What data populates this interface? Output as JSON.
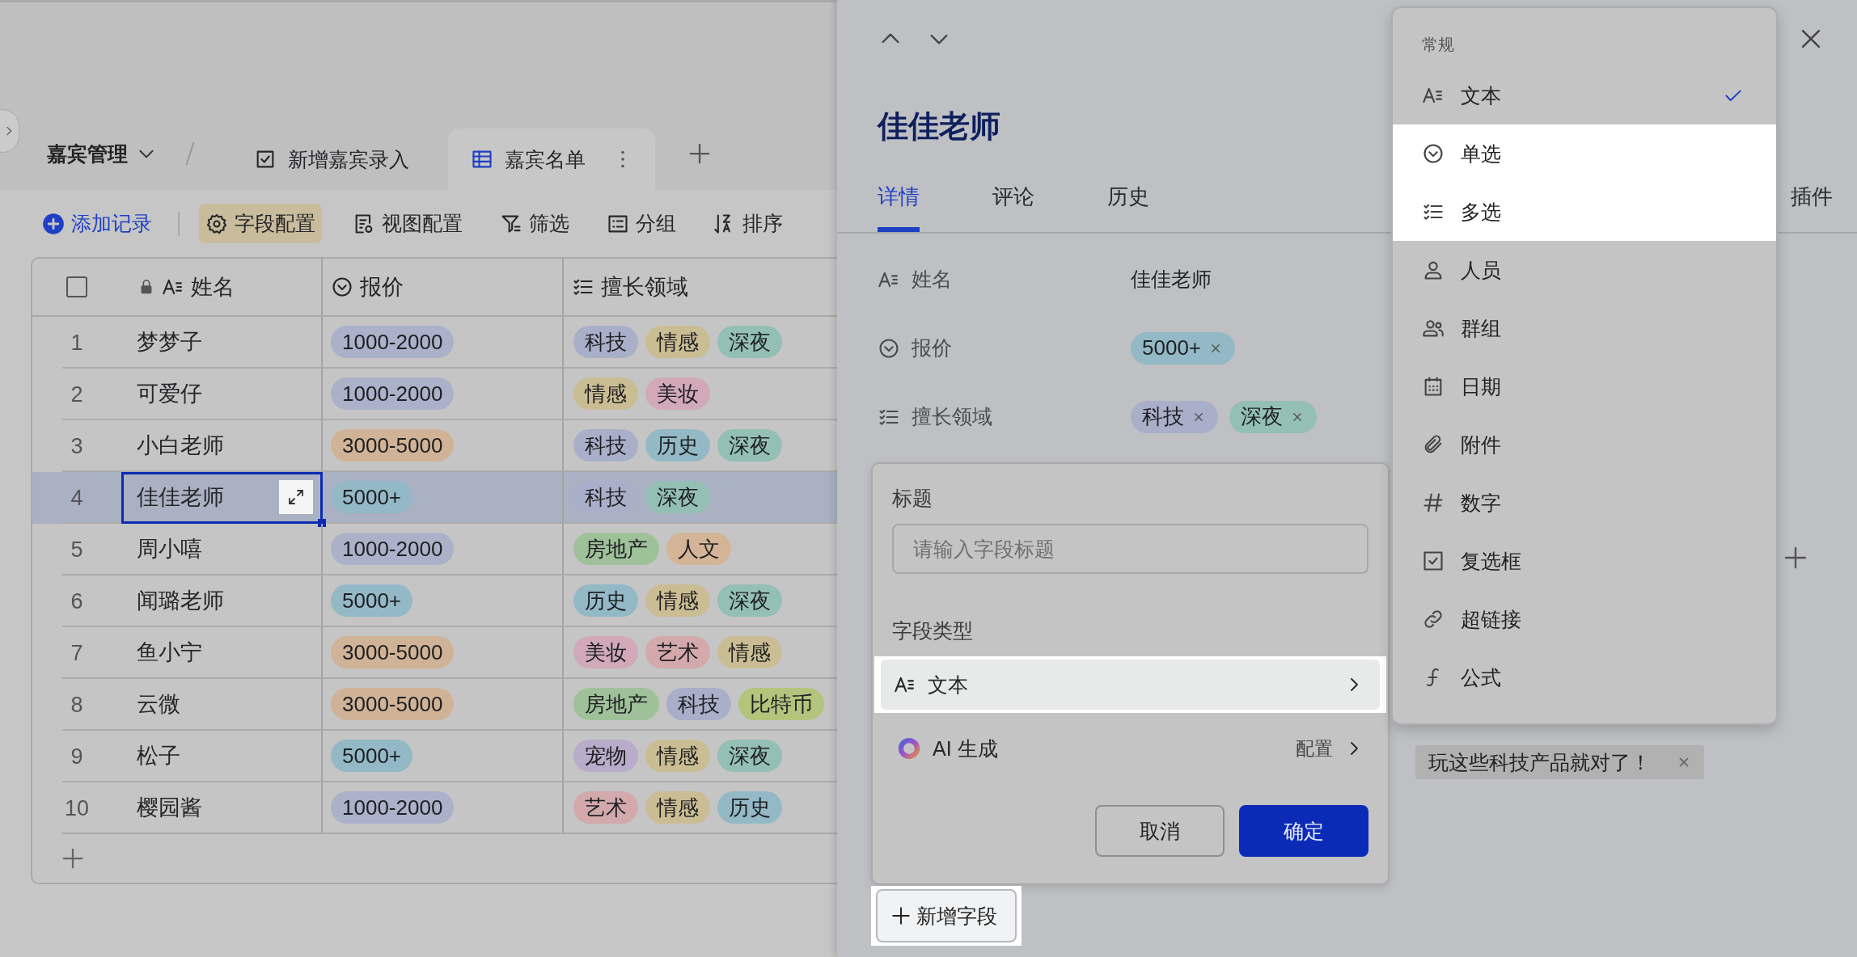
{
  "app": {
    "breadcrumb": "嘉宾管理",
    "tabs": [
      {
        "label": "新增嘉宾录入",
        "kind": "form",
        "selected": false
      },
      {
        "label": "嘉宾名单",
        "kind": "table",
        "selected": true
      }
    ],
    "toolbar": [
      {
        "label": "添加记录",
        "kind": "add",
        "active": false
      },
      {
        "label": "字段配置",
        "kind": "gear",
        "active": true
      },
      {
        "label": "视图配置",
        "kind": "view",
        "active": false
      },
      {
        "label": "筛选",
        "kind": "filter",
        "active": false
      },
      {
        "label": "分组",
        "kind": "groupby",
        "active": false
      },
      {
        "label": "排序",
        "kind": "sort",
        "active": false
      }
    ],
    "table": {
      "select_all": {
        "checked": false
      },
      "columns": [
        {
          "label": "姓名",
          "kind": "text",
          "locked": true
        },
        {
          "label": "报价",
          "kind": "single",
          "locked": false
        },
        {
          "label": "擅长领域",
          "kind": "multi",
          "locked": false
        }
      ],
      "rows": [
        {
          "index": "1",
          "name": "梦梦子",
          "selected": false,
          "price": {
            "label": "1000-2000",
            "color": "#aab1c9"
          },
          "domains": [
            {
              "label": "科技",
              "color": "#a9afc8"
            },
            {
              "label": "情感",
              "color": "#cbbd93"
            },
            {
              "label": "深夜",
              "color": "#93bfb4"
            }
          ]
        },
        {
          "index": "2",
          "name": "可爱仔",
          "selected": false,
          "price": {
            "label": "1000-2000",
            "color": "#aab1c9"
          },
          "domains": [
            {
              "label": "情感",
              "color": "#cbbd93"
            },
            {
              "label": "美妆",
              "color": "#d1a9b8"
            }
          ]
        },
        {
          "index": "3",
          "name": "小白老师",
          "selected": false,
          "price": {
            "label": "3000-5000",
            "color": "#d0b396"
          },
          "domains": [
            {
              "label": "科技",
              "color": "#a9afc8"
            },
            {
              "label": "历史",
              "color": "#93b9c6"
            },
            {
              "label": "深夜",
              "color": "#93bfb4"
            }
          ]
        },
        {
          "index": "4",
          "name": "佳佳老师",
          "selected": true,
          "price": {
            "label": "5000+",
            "color": "#93b8c6"
          },
          "domains": [
            {
              "label": "科技",
              "color": "#a9afc8"
            },
            {
              "label": "深夜",
              "color": "#93bfb4"
            }
          ]
        },
        {
          "index": "5",
          "name": "周小嘻",
          "selected": false,
          "price": {
            "label": "1000-2000",
            "color": "#aab1c9"
          },
          "domains": [
            {
              "label": "房地产",
              "color": "#9fc199"
            },
            {
              "label": "人文",
              "color": "#d3b497"
            }
          ]
        },
        {
          "index": "6",
          "name": "闻璐老师",
          "selected": false,
          "price": {
            "label": "5000+",
            "color": "#93b8c6"
          },
          "domains": [
            {
              "label": "历史",
              "color": "#93b9c6"
            },
            {
              "label": "情感",
              "color": "#cbbd93"
            },
            {
              "label": "深夜",
              "color": "#93bfb4"
            }
          ]
        },
        {
          "index": "7",
          "name": "鱼小宁",
          "selected": false,
          "price": {
            "label": "3000-5000",
            "color": "#d0b396"
          },
          "domains": [
            {
              "label": "美妆",
              "color": "#d1a9b8"
            },
            {
              "label": "艺术",
              "color": "#d3a9ab"
            },
            {
              "label": "情感",
              "color": "#cbbd93"
            }
          ]
        },
        {
          "index": "8",
          "name": "云微",
          "selected": false,
          "price": {
            "label": "3000-5000",
            "color": "#d0b396"
          },
          "domains": [
            {
              "label": "房地产",
              "color": "#9fc199"
            },
            {
              "label": "科技",
              "color": "#a9afc8"
            },
            {
              "label": "比特币",
              "color": "#b5c47c"
            }
          ]
        },
        {
          "index": "9",
          "name": "松子",
          "selected": false,
          "price": {
            "label": "5000+",
            "color": "#93b8c6"
          },
          "domains": [
            {
              "label": "宠物",
              "color": "#b9abca"
            },
            {
              "label": "情感",
              "color": "#cbbd93"
            },
            {
              "label": "深夜",
              "color": "#93bfb4"
            }
          ]
        },
        {
          "index": "10",
          "name": "樱园酱",
          "selected": false,
          "price": {
            "label": "1000-2000",
            "color": "#aab1c9"
          },
          "domains": [
            {
              "label": "艺术",
              "color": "#d3a9ab"
            },
            {
              "label": "情感",
              "color": "#cbbd93"
            },
            {
              "label": "历史",
              "color": "#93b9c6"
            }
          ]
        }
      ]
    }
  },
  "detail": {
    "title": "佳佳老师",
    "tabs": [
      {
        "label": "详情",
        "selected": true
      },
      {
        "label": "评论",
        "selected": false
      },
      {
        "label": "历史",
        "selected": false
      }
    ],
    "side_label": "插件",
    "fields": [
      {
        "label": "姓名",
        "kind": "text",
        "value": "佳佳老师"
      },
      {
        "label": "报价",
        "kind": "single",
        "tags": [
          {
            "label": "5000+",
            "color": "#93b8c6"
          }
        ]
      },
      {
        "label": "擅长领域",
        "kind": "multi",
        "tags": [
          {
            "label": "科技",
            "color": "#a9afc8"
          },
          {
            "label": "深夜",
            "color": "#93bfb4"
          }
        ]
      }
    ],
    "tag_chip": "玩这些科技产品就对了！"
  },
  "dialog": {
    "title_label": "标题",
    "title_placeholder": "请输入字段标题",
    "type_label": "字段类型",
    "type_value": {
      "label": "文本",
      "kind": "text",
      "highlighted": true
    },
    "ai": {
      "label": "AI 生成",
      "action": "配置"
    },
    "buttons": [
      {
        "label": "取消",
        "kind": "secondary"
      },
      {
        "label": "确定",
        "kind": "primary"
      }
    ]
  },
  "add_field": {
    "label": "新增字段",
    "highlighted": true
  },
  "type_menu": {
    "section": "常规",
    "items": [
      {
        "label": "文本",
        "kind": "text",
        "selected": true,
        "highlighted": false
      },
      {
        "label": "单选",
        "kind": "single",
        "selected": false,
        "highlighted": true
      },
      {
        "label": "多选",
        "kind": "multi",
        "selected": false,
        "highlighted": true
      },
      {
        "label": "人员",
        "kind": "person",
        "selected": false,
        "highlighted": false
      },
      {
        "label": "群组",
        "kind": "group",
        "selected": false,
        "highlighted": false
      },
      {
        "label": "日期",
        "kind": "date",
        "selected": false,
        "highlighted": false
      },
      {
        "label": "附件",
        "kind": "attach",
        "selected": false,
        "highlighted": false
      },
      {
        "label": "数字",
        "kind": "number",
        "selected": false,
        "highlighted": false
      },
      {
        "label": "复选框",
        "kind": "checkbox",
        "selected": false,
        "highlighted": false
      },
      {
        "label": "超链接",
        "kind": "link",
        "selected": false,
        "highlighted": false
      },
      {
        "label": "公式",
        "kind": "formula",
        "selected": false,
        "highlighted": false
      }
    ]
  }
}
